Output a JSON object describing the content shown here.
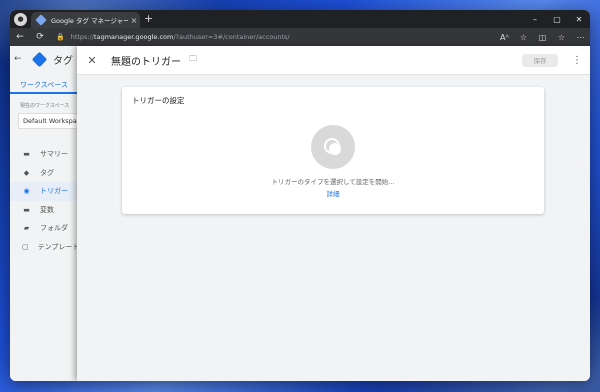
{
  "browser": {
    "tab_title": "Google タグ マネージャー",
    "tab_close_glyph": "×",
    "new_tab_glyph": "+",
    "url_prefix": "https://",
    "url_host": "tagmanager.google.com",
    "url_path": "/?authuser=3#/container/accounts/",
    "window_controls": [
      "–",
      "▢",
      "✕"
    ],
    "nav_glyphs": {
      "back": "←",
      "reload": "⟳",
      "lock": "🔒"
    },
    "toolbar_icons": [
      "read-aloud-icon",
      "favorite-icon",
      "split-screen-icon",
      "favorites-icon",
      "more-icon"
    ],
    "toolbar_glyphs": [
      "Aᴬ",
      "☆",
      "◫",
      "☆",
      "⋯"
    ]
  },
  "sidebar": {
    "back_glyph": "←",
    "app_name": "タグ",
    "workspace_tab": "ワークスペース",
    "workspace_label": "現在のワークスペース",
    "workspace_value": "Default Workspace",
    "items": [
      {
        "label": "サマリー",
        "icon": "summary-icon",
        "glyph": "▬"
      },
      {
        "label": "タグ",
        "icon": "tag-icon",
        "glyph": "◆"
      },
      {
        "label": "トリガー",
        "icon": "trigger-icon",
        "glyph": "◉",
        "active": true
      },
      {
        "label": "変数",
        "icon": "variables-icon",
        "glyph": "▬"
      },
      {
        "label": "フォルダ",
        "icon": "folder-icon",
        "glyph": "▰"
      },
      {
        "label": "テンプレート",
        "icon": "template-icon",
        "glyph": "▢"
      }
    ]
  },
  "panel": {
    "close_glyph": "✕",
    "title": "無題のトリガー",
    "folder_glyph": "🗀",
    "save_label": "保存",
    "more_glyph": "⋮"
  },
  "card": {
    "title": "トリガーの設定",
    "prompt": "トリガーのタイプを選択して設定を開始...",
    "details_link": "詳細"
  },
  "colors": {
    "accent": "#1a73e8",
    "titlebar": "#202124",
    "navbar": "#35363a"
  }
}
